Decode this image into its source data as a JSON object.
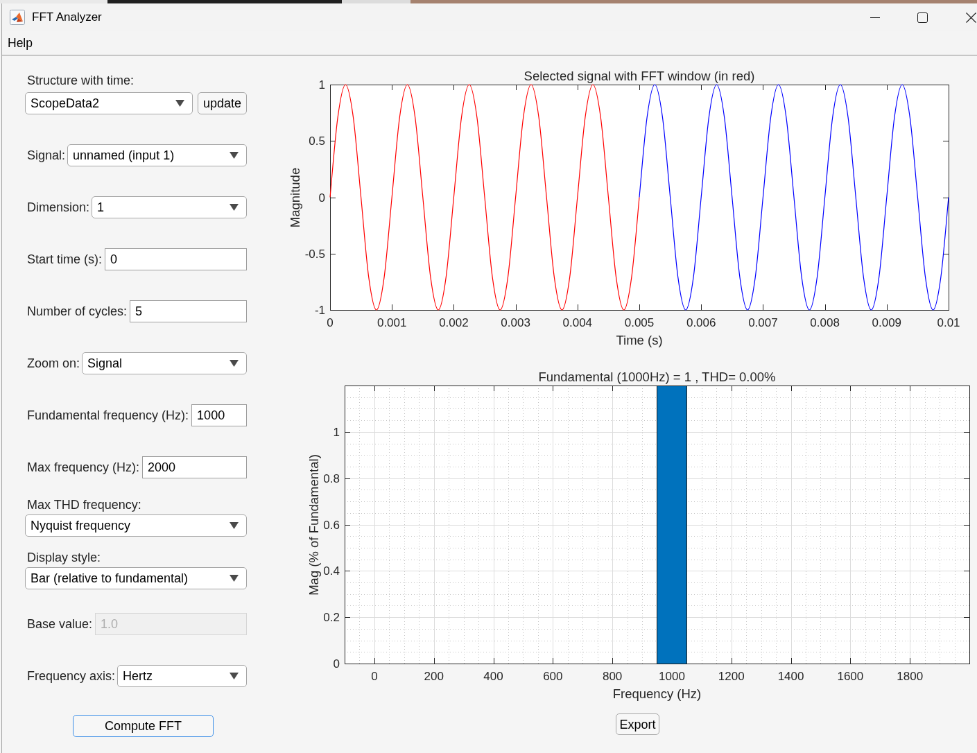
{
  "window": {
    "title": "FFT Analyzer"
  },
  "menu_bar": [
    {
      "label": "Help"
    }
  ],
  "controls": [
    {
      "kind": "dropdown_with_button",
      "label": "Structure with time:",
      "value": "ScopeData2",
      "button": "update"
    },
    {
      "kind": "dropdown",
      "label": "Signal:",
      "value": "unnamed (input 1)"
    },
    {
      "kind": "dropdown",
      "label": "Dimension:",
      "value": "1"
    },
    {
      "kind": "field",
      "label": "Start time (s):",
      "value": "0",
      "disabled": false
    },
    {
      "kind": "field",
      "label": "Number of cycles:",
      "value": "5",
      "disabled": false
    },
    {
      "kind": "dropdown",
      "label": "Zoom on:",
      "value": "Signal"
    },
    {
      "kind": "field",
      "label": "Fundamental frequency (Hz):",
      "value": "1000",
      "disabled": false
    },
    {
      "kind": "field",
      "label": "Max frequency (Hz):",
      "value": "2000",
      "disabled": false
    },
    {
      "kind": "stacked_dropdown",
      "label": "Max THD frequency:",
      "value": "Nyquist frequency"
    },
    {
      "kind": "stacked_dropdown",
      "label": "Display style:",
      "value": "Bar (relative to fundamental)"
    },
    {
      "kind": "field",
      "label": "Base value:",
      "value": "1.0",
      "disabled": true
    },
    {
      "kind": "dropdown",
      "label": "Frequency axis:",
      "value": "Hertz"
    }
  ],
  "compute_button": {
    "label": "Compute FFT",
    "focused": true
  },
  "time_plot": {
    "chart_data": {
      "type": "line",
      "title": "Selected signal with FFT window (in red)",
      "xlabel": "Time (s)",
      "ylabel": "Magnitude",
      "x": [
        0,
        0.000125,
        0.00025,
        0.000375,
        0.0005,
        0.000625,
        0.00075,
        0.000875,
        0.001,
        0.001125,
        0.00125,
        0.001375,
        0.0015,
        0.001625,
        0.00175,
        0.001875,
        0.002,
        0.002125,
        0.00225,
        0.002375,
        0.0025,
        0.002625,
        0.00275,
        0.002875,
        0.003,
        0.003125,
        0.00325,
        0.003375,
        0.0035,
        0.003625,
        0.00375,
        0.003875,
        0.004,
        0.004125,
        0.00425,
        0.004375,
        0.0045,
        0.004625,
        0.00475,
        0.004875,
        0.005,
        0.005125,
        0.00525,
        0.005375,
        0.0055,
        0.005625,
        0.00575,
        0.005875,
        0.006,
        0.006125,
        0.00625,
        0.006375,
        0.0065,
        0.006625,
        0.00675,
        0.006875,
        0.007,
        0.007125,
        0.00725,
        0.007375,
        0.0075,
        0.007625,
        0.00775,
        0.007875,
        0.008,
        0.008125,
        0.00825,
        0.008375,
        0.0085,
        0.008625,
        0.00875,
        0.008875,
        0.009,
        0.009125,
        0.00925,
        0.009375,
        0.0095,
        0.009625,
        0.00975,
        0.009875,
        0.01
      ],
      "series": [
        {
          "color": "#ff0000",
          "values": [
            0,
            0.71,
            1,
            0.71,
            0,
            -0.71,
            -1,
            -0.71,
            0,
            0.71,
            1,
            0.71,
            0,
            -0.71,
            -1,
            -0.71,
            0,
            0.71,
            1,
            0.71,
            0,
            -0.71,
            -1,
            -0.71,
            0,
            0.71,
            1,
            0.71,
            0,
            -0.71,
            -1,
            -0.71,
            0,
            0.71,
            1,
            0.71,
            0,
            -0.71,
            -1,
            -0.71,
            0,
            null,
            null,
            null,
            null,
            null,
            null,
            null,
            null,
            null,
            null,
            null,
            null,
            null,
            null,
            null,
            null,
            null,
            null,
            null,
            null,
            null,
            null,
            null,
            null,
            null,
            null,
            null,
            null,
            null,
            null,
            null,
            null,
            null,
            null,
            null,
            null,
            null,
            null,
            null,
            null
          ]
        },
        {
          "color": "#0000ff",
          "values": [
            null,
            null,
            null,
            null,
            null,
            null,
            null,
            null,
            null,
            null,
            null,
            null,
            null,
            null,
            null,
            null,
            null,
            null,
            null,
            null,
            null,
            null,
            null,
            null,
            null,
            null,
            null,
            null,
            null,
            null,
            null,
            null,
            null,
            null,
            null,
            null,
            null,
            null,
            null,
            null,
            0,
            0.71,
            1,
            0.71,
            0,
            -0.71,
            -1,
            -0.71,
            0,
            0.71,
            1,
            0.71,
            0,
            -0.71,
            -1,
            -0.71,
            0,
            0.71,
            1,
            0.71,
            0,
            -0.71,
            -1,
            -0.71,
            0,
            0.71,
            1,
            0.71,
            0,
            -0.71,
            -1,
            -0.71,
            0,
            0.71,
            1,
            0.71,
            0,
            -0.71,
            -1,
            -0.71,
            0
          ]
        }
      ],
      "xlim": [
        0,
        0.01
      ],
      "ylim": [
        -1,
        1
      ],
      "xticks": [
        0,
        0.001,
        0.002,
        0.003,
        0.004,
        0.005,
        0.006,
        0.007,
        0.008,
        0.009,
        0.01
      ],
      "yticks": [
        -1,
        -0.5,
        0,
        0.5,
        1
      ]
    }
  },
  "spectrum_plot": {
    "chart_data": {
      "type": "bar",
      "title": "Fundamental (1000Hz) = 1 , THD= 0.00%",
      "xlabel": "Frequency (Hz)",
      "ylabel": "Mag (% of Fundamental)",
      "x": [
        1000
      ],
      "values": [
        1.2
      ],
      "xlim": [
        -100,
        2000
      ],
      "ylim": [
        0,
        1.2
      ],
      "xticks": [
        0,
        200,
        400,
        600,
        800,
        1000,
        1200,
        1400,
        1600,
        1800
      ],
      "yticks": [
        0,
        0.2,
        0.4,
        0.6,
        0.8,
        1
      ],
      "grid": true
    }
  },
  "export_button": {
    "label": "Export"
  }
}
